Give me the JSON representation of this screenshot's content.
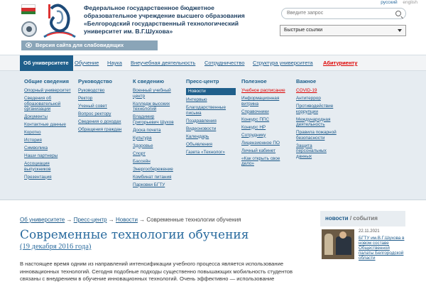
{
  "header": {
    "university_name": "Федеральное государственное бюджетное образовательное учреждение высшего образования «Белгородский государственный технологический университет им. В.Г.Шухова»",
    "lang_active": "русский",
    "lang_inactive": "english",
    "search_placeholder": "Введите запрос",
    "quick_links_label": "Быстрые ссылки",
    "impaired_label": "Версия сайта для слабовидящих",
    "icons": [
      "flag-icon",
      "seal-icon",
      "logo-icon",
      "search-icon",
      "chevron-down-icon",
      "eye-icon"
    ]
  },
  "nav": {
    "items": [
      "Об университете",
      "Обучение",
      "Наука",
      "Внеучебная деятельность",
      "Сотрудничество",
      "Структура университета",
      "Абитуриенту"
    ]
  },
  "mega_menu": {
    "columns": [
      {
        "title": "Общие сведения",
        "links": [
          "Опорный университет",
          "Сведения об образовательной организации",
          "Документы",
          "Контактные данные",
          "Коротко",
          "История",
          "Символика",
          "Наши партнеры",
          "Ассоциация выпускников",
          "Презентация"
        ]
      },
      {
        "title": "Руководство",
        "links": [
          "Руководство",
          "Ректор",
          "Ученый совет",
          "Вопрос ректору",
          "Сведения о доходах",
          "Обращения граждан"
        ]
      },
      {
        "title": "К сведению",
        "links": [
          "Военный учебный центр",
          "Колледж высоких технологий",
          "Владимир Григорьевич Шухов",
          "Доска почета",
          "Культура",
          "Здоровье",
          "Спорт",
          "Бассейн",
          "Энергосбережение",
          "Комбинат питания",
          "Парковки БГТУ"
        ]
      },
      {
        "title": "Пресс-центр",
        "links": [
          "Новости",
          "Интервью",
          "Благодарственные письма",
          "Поздравления",
          "Видеоновости",
          "Календарь",
          "Объявления",
          "Газета «Технолог»"
        ]
      },
      {
        "title": "Полезное",
        "links": [
          "Учебное расписание",
          "Информационная витрина",
          "Справочники",
          "Конкурс ППС",
          "Конкурс НР",
          "Сотруднику",
          "Лицензионное ПО",
          "Личный кабинет",
          "«Как открыть свое дело»"
        ]
      },
      {
        "title": "Важное",
        "links": [
          "COVID-19",
          "Антитеррор",
          "Противодействие коррупции",
          "Международная деятельность",
          "Правила пожарной безопасности",
          "Защита персональных данных"
        ]
      }
    ]
  },
  "breadcrumb": {
    "items": [
      "Об университете",
      "Пресс-центр",
      "Новости",
      "Современные технологии обучения"
    ],
    "separator": "→"
  },
  "article": {
    "title": "Современные технологии обучения",
    "date": "(19 декабря 2016 года)",
    "lines": [
      "В настоящее время одним из направлений интенсификации учебного процесса является использование",
      "инновационных технологий. Сегодня подобные подходы существенно повышающих мобильность студентов",
      "связаны с внедрением в обучение инновационных технологий. Очень эффективно — использование"
    ]
  },
  "news": {
    "head_news": "новости",
    "head_sep": " / ",
    "head_events": "события",
    "date": "22.11.2021",
    "link": "БГТУ им.В.Г.Шухова в новом составе Общественной палаты Белгородской области"
  },
  "colors": {
    "primary": "#1f5f8b",
    "link": "#1d5a8a",
    "title": "#2a6b9e",
    "accent_red": "#d00000",
    "menu_bg": "#e6ecf1",
    "impaired_bg": "#8aa5b8"
  }
}
